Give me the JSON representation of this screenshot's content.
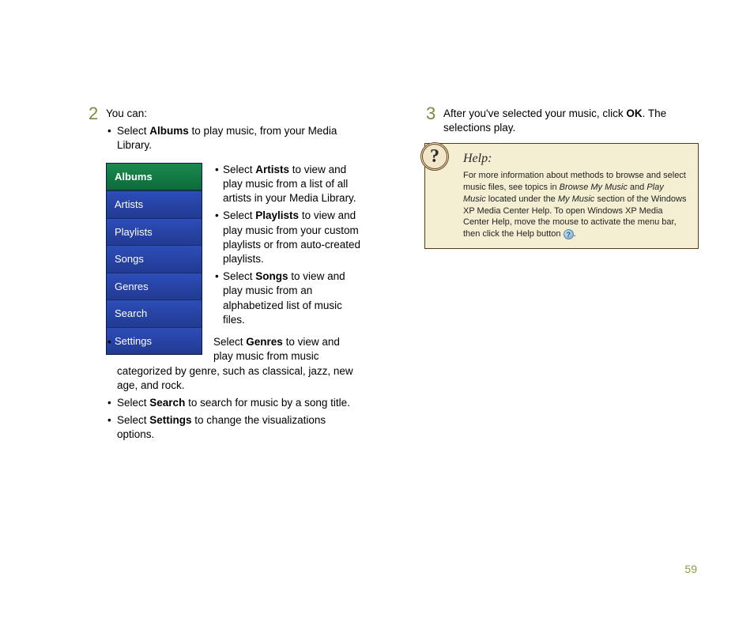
{
  "step2": {
    "num": "2",
    "intro": "You can:",
    "bullets": {
      "albums_pre": "Select ",
      "albums_bold": "Albums",
      "albums_post": " to play music, from your Media Library.",
      "artists_pre": "Select ",
      "artists_bold": "Artists",
      "artists_post": " to view and play music from a list of all artists in your Media Library.",
      "playlists_pre": "Select ",
      "playlists_bold": "Playlists",
      "playlists_post": " to view and play music from your custom playlists or from auto-created playlists.",
      "songs_pre": "Select ",
      "songs_bold": "Songs",
      "songs_post": " to view and play music from an alphabetized list of music files.",
      "genres_pre": "Select ",
      "genres_bold": "Genres",
      "genres_post": " to view and play music from music categorized by genre, such as classical, jazz, new age, and rock.",
      "search_pre": "Select ",
      "search_bold": "Search",
      "search_post": " to search for music by a song title.",
      "settings_pre": "Select ",
      "settings_bold": "Settings",
      "settings_post": " to change the visualizations options."
    }
  },
  "menu": {
    "items": [
      {
        "label": "Albums",
        "selected": true
      },
      {
        "label": "Artists"
      },
      {
        "label": "Playlists"
      },
      {
        "label": "Songs"
      },
      {
        "label": "Genres"
      },
      {
        "label": "Search"
      },
      {
        "label": "Settings"
      }
    ]
  },
  "step3": {
    "num": "3",
    "pre": "After you've selected your music, click ",
    "ok": "OK",
    "post": ". The selections play."
  },
  "help": {
    "glyph": "?",
    "title": "Help:",
    "text_a": "For more information about methods to browse and select music files, see topics in ",
    "i1": "Browse My Music",
    "text_b": " and ",
    "i2": "Play Music",
    "text_c": " located under the ",
    "i3": "My Music",
    "text_d": " section of the Windows XP Media Center Help. To open Windows XP Media Center Help, move the mouse to activate the menu bar, then click the Help button ",
    "small_glyph": "?",
    "text_e": "."
  },
  "page_number": "59"
}
